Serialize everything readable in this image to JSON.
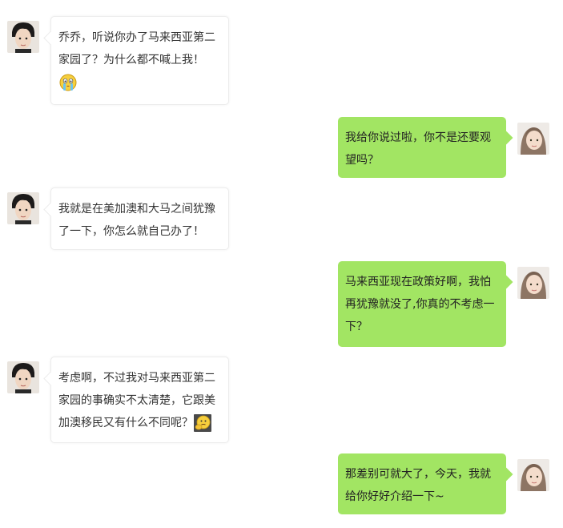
{
  "conversation": {
    "messages": [
      {
        "side": "left",
        "text": "乔乔，听说你办了马来西亚第二家园了？为什么都不喊上我！",
        "emoji": "crying-face-emoji"
      },
      {
        "side": "right",
        "text": "我给你说过啦，你不是还要观望吗？"
      },
      {
        "side": "left",
        "text": "我就是在美加澳和大马之间犹豫了一下，你怎么就自己办了！"
      },
      {
        "side": "right",
        "text": "马来西亚现在政策好啊，我怕再犹豫就没了,你真的不考虑一下？"
      },
      {
        "side": "left",
        "text": "考虑啊，不过我对马来西亚第二家园的事确实不太清楚，它跟美加澳移民又有什么不同呢？",
        "emoji": "thinking-face-emoji"
      },
      {
        "side": "right",
        "text": "那差别可就大了，今天，我就给你好好介绍一下~"
      }
    ]
  },
  "colors": {
    "right_bubble": "#a2e563",
    "left_bubble": "#ffffff",
    "text": "#333333"
  }
}
